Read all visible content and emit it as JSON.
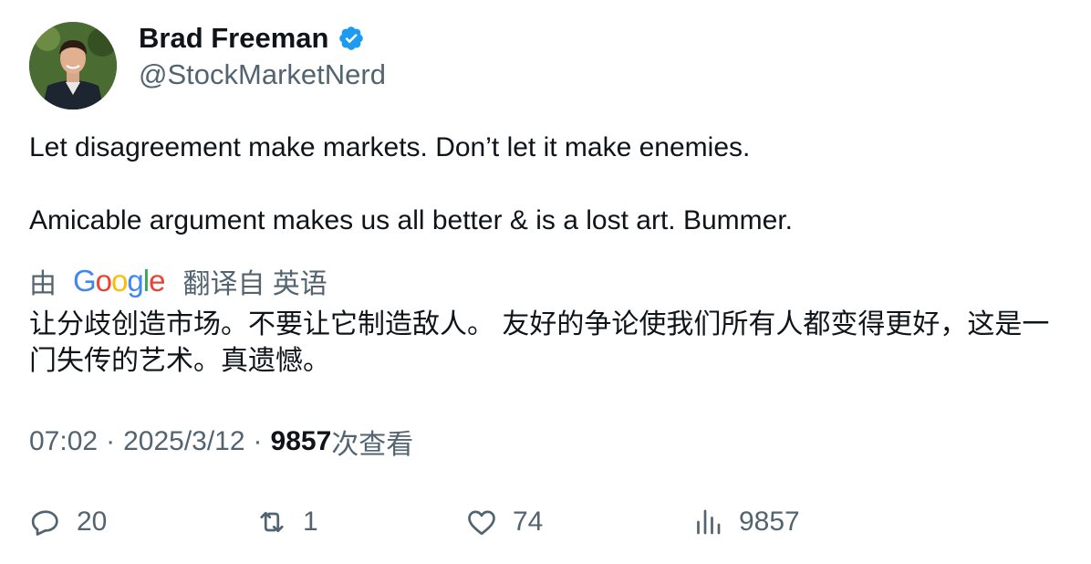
{
  "author": {
    "name": "Brad Freeman",
    "handle": "@StockMarketNerd",
    "verified": true
  },
  "tweet": {
    "paragraphs": [
      "Let disagreement make markets. Don’t let it make enemies.",
      "Amicable argument makes us all better & is a lost art. Bummer."
    ]
  },
  "translation": {
    "by_prefix": "由",
    "provider_letters": [
      "G",
      "o",
      "o",
      "g",
      "l",
      "e"
    ],
    "link_text": "翻译自 英语",
    "text": "让分歧创造市场。不要让它制造敌人。 友好的争论使我们所有人都变得更好，这是一门失传的艺术。真遗憾。"
  },
  "meta": {
    "time": "07:02",
    "separator": "·",
    "date": "2025/3/12",
    "views_count": "9857",
    "views_label": "次查看"
  },
  "actions": {
    "reply_count": "20",
    "retweet_count": "1",
    "like_count": "74",
    "views_count": "9857"
  },
  "colors": {
    "text_primary": "#0f1419",
    "text_secondary": "#536471",
    "verified_blue": "#1d9bf0"
  },
  "icons": {
    "verified": "verified-badge-icon",
    "reply": "reply-icon",
    "retweet": "retweet-icon",
    "like": "heart-icon",
    "views": "views-bar-chart-icon"
  }
}
